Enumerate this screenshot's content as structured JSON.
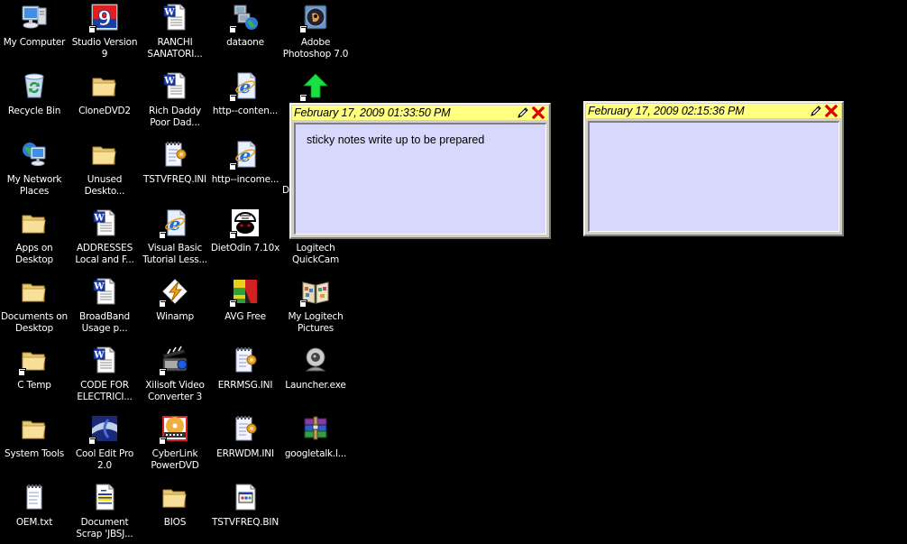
{
  "desktop": {
    "icons": [
      {
        "label": "My Computer",
        "icon": "my-computer-icon",
        "shortcut": false
      },
      {
        "label": "Studio Version\n9",
        "icon": "studio-9-icon",
        "shortcut": true
      },
      {
        "label": "RANCHI\nSANATORI...",
        "icon": "word-doc-icon",
        "shortcut": false
      },
      {
        "label": "dataone",
        "icon": "network-connection-icon",
        "shortcut": true
      },
      {
        "label": "Adobe\nPhotoshop 7.0",
        "icon": "photoshop-icon",
        "shortcut": true
      },
      {
        "label": "Recycle Bin",
        "icon": "recycle-bin-icon",
        "shortcut": false
      },
      {
        "label": "CloneDVD2",
        "icon": "folder-icon",
        "shortcut": false
      },
      {
        "label": "Rich Daddy\nPoor Dad...",
        "icon": "word-doc-icon",
        "shortcut": false
      },
      {
        "label": "http--conten...",
        "icon": "ie-link-icon",
        "shortcut": true
      },
      {
        "label": "",
        "icon": "green-arrow-icon",
        "shortcut": true
      },
      {
        "label": "My Network\nPlaces",
        "icon": "network-places-icon",
        "shortcut": false
      },
      {
        "label": "Unused\nDeskto...",
        "icon": "folder-icon",
        "shortcut": false
      },
      {
        "label": "TSTVFREQ.INI",
        "icon": "ini-file-icon",
        "shortcut": false
      },
      {
        "label": "http--income...",
        "icon": "ie-link-icon",
        "shortcut": true
      },
      {
        "label": "Apps on\nDesktop",
        "icon": "folder-icon",
        "shortcut": false
      },
      {
        "label": "ADDRESSES\nLocal and F...",
        "icon": "word-doc-icon",
        "shortcut": false
      },
      {
        "label": "Visual Basic\nTutorial Less...",
        "icon": "ie-link-icon",
        "shortcut": true
      },
      {
        "label": "DietOdin 7.10x",
        "icon": "dietodin-icon",
        "shortcut": true
      },
      {
        "label": "Logitech\nQuickCam",
        "icon": "",
        "shortcut": false
      },
      {
        "label": "Documents on\nDesktop",
        "icon": "folder-icon",
        "shortcut": false
      },
      {
        "label": "BroadBand\nUsage p...",
        "icon": "word-doc-icon",
        "shortcut": false
      },
      {
        "label": "Winamp",
        "icon": "winamp-icon",
        "shortcut": true
      },
      {
        "label": "AVG Free",
        "icon": "avg-icon",
        "shortcut": true
      },
      {
        "label": "My Logitech\nPictures",
        "icon": "photo-album-icon",
        "shortcut": true
      },
      {
        "label": "C Temp",
        "icon": "folder-icon",
        "shortcut": true
      },
      {
        "label": "CODE FOR\nELECTRICI...",
        "icon": "word-doc-icon",
        "shortcut": false
      },
      {
        "label": "Xilisoft Video\nConverter 3",
        "icon": "xilisoft-icon",
        "shortcut": true
      },
      {
        "label": "ERRMSG.INI",
        "icon": "ini-file-icon",
        "shortcut": false
      },
      {
        "label": "Launcher.exe",
        "icon": "webcam-icon",
        "shortcut": false
      },
      {
        "label": "System Tools",
        "icon": "folder-icon",
        "shortcut": false
      },
      {
        "label": "Cool Edit Pro\n2.0",
        "icon": "cool-edit-icon",
        "shortcut": true
      },
      {
        "label": "CyberLink\nPowerDVD",
        "icon": "powerdvd-icon",
        "shortcut": true
      },
      {
        "label": "ERRWDM.INI",
        "icon": "ini-file-icon",
        "shortcut": false
      },
      {
        "label": "googletalk.l...",
        "icon": "winrar-icon",
        "shortcut": false
      },
      {
        "label": "OEM.txt",
        "icon": "text-file-icon",
        "shortcut": false
      },
      {
        "label": "Document\nScrap 'JBSJ...",
        "icon": "scrap-doc-icon",
        "shortcut": false
      },
      {
        "label": "BIOS",
        "icon": "folder-icon",
        "shortcut": false
      },
      {
        "label": "TSTVFREQ.BIN",
        "icon": "bin-file-icon",
        "shortcut": false
      }
    ],
    "partial_label": "D"
  },
  "sticky_notes": [
    {
      "title": "February 17, 2009 01:33:50 PM",
      "body": "sticky notes write up to be prepared"
    },
    {
      "title": "February 17, 2009 02:15:36 PM",
      "body": ""
    }
  ],
  "colors": {
    "desktop_bg": "#000000",
    "note_title_bg": "#ffff80",
    "note_body_bg": "#d8d8fc",
    "close_red": "#e00000"
  }
}
